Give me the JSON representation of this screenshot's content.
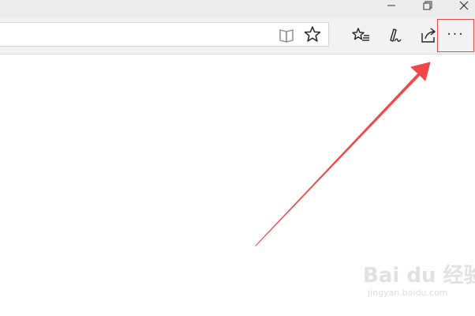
{
  "window": {
    "controls": {
      "minimize_icon": "minimize-icon",
      "restore_icon": "restore-icon",
      "close_icon": "close-icon"
    }
  },
  "toolbar": {
    "address": {
      "value": "",
      "placeholder": ""
    },
    "icons": {
      "reading_view": "reading-view-icon",
      "favorite": "star-icon",
      "hub": "favorites-hub-icon",
      "web_note": "pen-icon",
      "share": "share-icon",
      "more": "more-dots-icon"
    },
    "more_label": "···",
    "highlight_color": "#e34b4b"
  },
  "annotation": {
    "arrow_color": "#f04848",
    "arrow_target": "more-button"
  },
  "watermark": {
    "brand": "Bai du 经验",
    "url": "jingyan.baidu.com"
  }
}
